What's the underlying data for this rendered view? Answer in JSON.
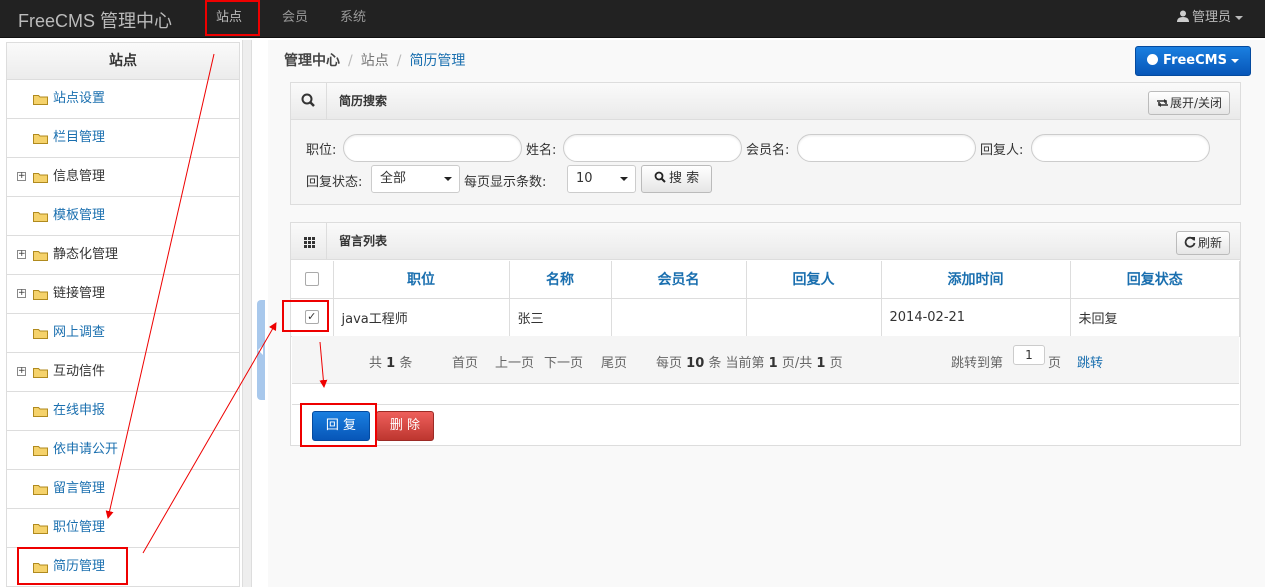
{
  "app": {
    "brand": "FreeCMS 管理中心"
  },
  "topnav": [
    {
      "label": "站点"
    },
    {
      "label": "会员"
    },
    {
      "label": "系统"
    }
  ],
  "user": {
    "label": "管理员"
  },
  "sidebar": {
    "title": "站点",
    "items": [
      {
        "label": "站点设置",
        "expandable": false
      },
      {
        "label": "栏目管理",
        "expandable": false
      },
      {
        "label": "信息管理",
        "expandable": true
      },
      {
        "label": "模板管理",
        "expandable": false
      },
      {
        "label": "静态化管理",
        "expandable": true
      },
      {
        "label": "链接管理",
        "expandable": true
      },
      {
        "label": "网上调查",
        "expandable": false
      },
      {
        "label": "互动信件",
        "expandable": true
      },
      {
        "label": "在线申报",
        "expandable": false
      },
      {
        "label": "依申请公开",
        "expandable": false
      },
      {
        "label": "留言管理",
        "expandable": false
      },
      {
        "label": "职位管理",
        "expandable": false
      },
      {
        "label": "简历管理",
        "expandable": false
      }
    ]
  },
  "breadcrumb": {
    "home": "管理中心",
    "section": "站点",
    "current": "简历管理"
  },
  "brand_button": {
    "label": "FreeCMS"
  },
  "search_panel": {
    "title": "简历搜索",
    "toggle_label": "展开/关闭",
    "fields": {
      "position_label": "职位:",
      "name_label": "姓名:",
      "member_label": "会员名:",
      "replier_label": "回复人:",
      "reply_state_label": "回复状态:",
      "reply_state_value": "全部",
      "page_size_label": "每页显示条数:",
      "page_size_value": "10"
    },
    "search_label": "搜 索"
  },
  "list_panel": {
    "title": "留言列表",
    "refresh_label": "刷新",
    "columns": [
      "职位",
      "名称",
      "会员名",
      "回复人",
      "添加时间",
      "回复状态"
    ],
    "rows": [
      {
        "checked": true,
        "cells": [
          "java工程师",
          "张三",
          "",
          "",
          "2014-02-21",
          "未回复"
        ]
      }
    ],
    "pager": {
      "total_pre": "共",
      "total": "1",
      "total_post": "条",
      "first": "首页",
      "prev": "上一页",
      "next": "下一页",
      "last": "尾页",
      "per_page_pre": "每页",
      "per_page": "10",
      "per_page_mid": "条 当前第",
      "current": "1",
      "page_of": "页/共",
      "pages": "1",
      "page_end": "页",
      "jump_label": "跳转到第",
      "jump_value": "1",
      "jump_unit": "页",
      "jump_button": "跳转"
    },
    "reply_label": "回 复",
    "delete_label": "删 除"
  },
  "colors": {
    "topbar": "#222222",
    "link": "#1a6faf",
    "primary": "#0b63c8",
    "danger": "#d9534f",
    "highlight": "#e00000"
  }
}
